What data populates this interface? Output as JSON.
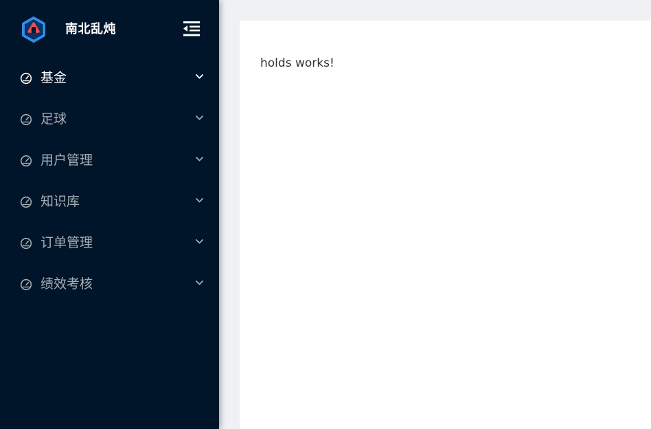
{
  "brand": {
    "name": "南北乱炖",
    "logo_icon": "hexagon-logo-icon",
    "logo_colors": [
      "#2d8cf0",
      "#ed4e5a"
    ]
  },
  "sidebar": {
    "background": "#001529",
    "collapse_icon": "menu-fold-icon",
    "items": [
      {
        "label": "基金",
        "icon": "dashboard-icon",
        "active": true
      },
      {
        "label": "足球",
        "icon": "dashboard-icon",
        "active": false
      },
      {
        "label": "用户管理",
        "icon": "dashboard-icon",
        "active": false
      },
      {
        "label": "知识库",
        "icon": "dashboard-icon",
        "active": false
      },
      {
        "label": "订单管理",
        "icon": "dashboard-icon",
        "active": false
      },
      {
        "label": "绩效考核",
        "icon": "dashboard-icon",
        "active": false
      }
    ]
  },
  "main": {
    "message": "holds works!"
  }
}
